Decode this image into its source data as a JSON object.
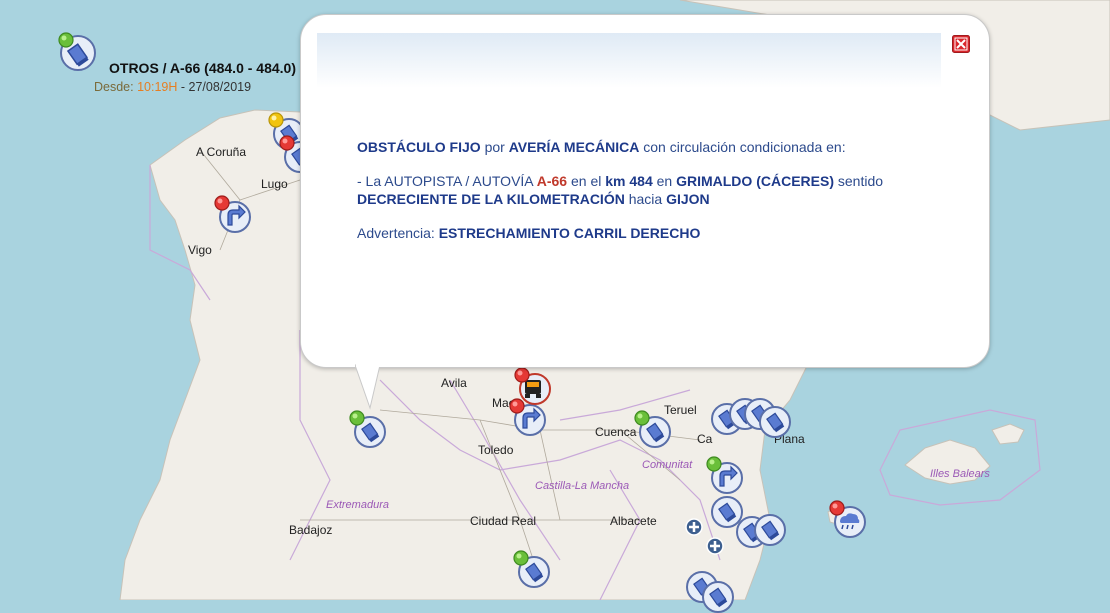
{
  "map": {
    "cities": [
      {
        "name": "A Coruña"
      },
      {
        "name": "Lugo"
      },
      {
        "name": "Vigo"
      },
      {
        "name": "Avila"
      },
      {
        "name": "Mac"
      },
      {
        "name": "Toledo"
      },
      {
        "name": "Cuenca"
      },
      {
        "name": "Teruel"
      },
      {
        "name": "Ca"
      },
      {
        "name": "Plana"
      },
      {
        "name": "Badajoz"
      },
      {
        "name": "Ciudad Real"
      },
      {
        "name": "Albacete"
      }
    ],
    "regions": [
      {
        "name": "Extremadura"
      },
      {
        "name": "Castilla-La Mancha"
      },
      {
        "name": "Comunitat"
      },
      {
        "name": "Illes Balears"
      }
    ],
    "markers": [
      {
        "icon": "roadwork-sign-icon",
        "status": "yellow"
      },
      {
        "icon": "roadwork-sign-icon",
        "status": "red"
      },
      {
        "icon": "turn-right-arrow-icon",
        "status": "red"
      },
      {
        "icon": "roadwork-sign-icon",
        "status": "green"
      },
      {
        "icon": "turn-right-arrow-icon",
        "status": "red"
      },
      {
        "icon": "truck-icon",
        "status": "red"
      },
      {
        "icon": "roadwork-sign-icon",
        "status": "green"
      },
      {
        "icon": "roadwork-sign-icon",
        "status": "none"
      },
      {
        "icon": "roadwork-sign-icon",
        "status": "none"
      },
      {
        "icon": "roadwork-sign-icon",
        "status": "none"
      },
      {
        "icon": "roadwork-sign-icon",
        "status": "none"
      },
      {
        "icon": "turn-right-arrow-icon",
        "status": "green"
      },
      {
        "icon": "roadwork-sign-icon",
        "status": "none"
      },
      {
        "icon": "roadwork-sign-icon",
        "status": "none"
      },
      {
        "icon": "roadwork-sign-icon",
        "status": "none"
      },
      {
        "icon": "weather-rain-icon",
        "status": "red"
      },
      {
        "icon": "roadwork-sign-icon",
        "status": "green"
      },
      {
        "icon": "roadwork-sign-icon",
        "status": "none"
      },
      {
        "icon": "roadwork-sign-icon",
        "status": "none"
      }
    ],
    "crosses": [
      {
        "icon": "medical-cross-icon"
      },
      {
        "icon": "medical-cross-icon"
      }
    ]
  },
  "popup": {
    "title": "OTROS / A-66 (484.0 - 484.0)",
    "since_label": "Desde:",
    "since_time": "10:19H",
    "since_date": "- 27/08/2019",
    "line1": {
      "obstacle": "OBSTÁCULO FIJO",
      "por": "por",
      "cause": "AVERÍA MECÁNICA",
      "rest": "con circulación condicionada en:"
    },
    "line2": {
      "prefix": "- La",
      "road_type": "AUTOPISTA / AUTOVÍA",
      "road": "A-66",
      "en_el": "en el",
      "km": "km 484",
      "en": "en",
      "place": "GRIMALDO (CÁCERES)",
      "sentido": "sentido",
      "direction": "DECRECIENTE DE LA KILOMETRACIÓN",
      "hacia": "hacia",
      "destination": "GIJON"
    },
    "warning": {
      "label": "Advertencia:",
      "text": "ESTRECHAMIENTO CARRIL DERECHO"
    }
  },
  "colors": {
    "sea": "#a9d3df",
    "land": "#f1eee8",
    "status_green": "#4caf50",
    "status_red": "#e53935",
    "status_yellow": "#f1c40f",
    "text_blue": "#2c4a8c",
    "road_red": "#c0392b",
    "time_orange": "#e67e22"
  }
}
